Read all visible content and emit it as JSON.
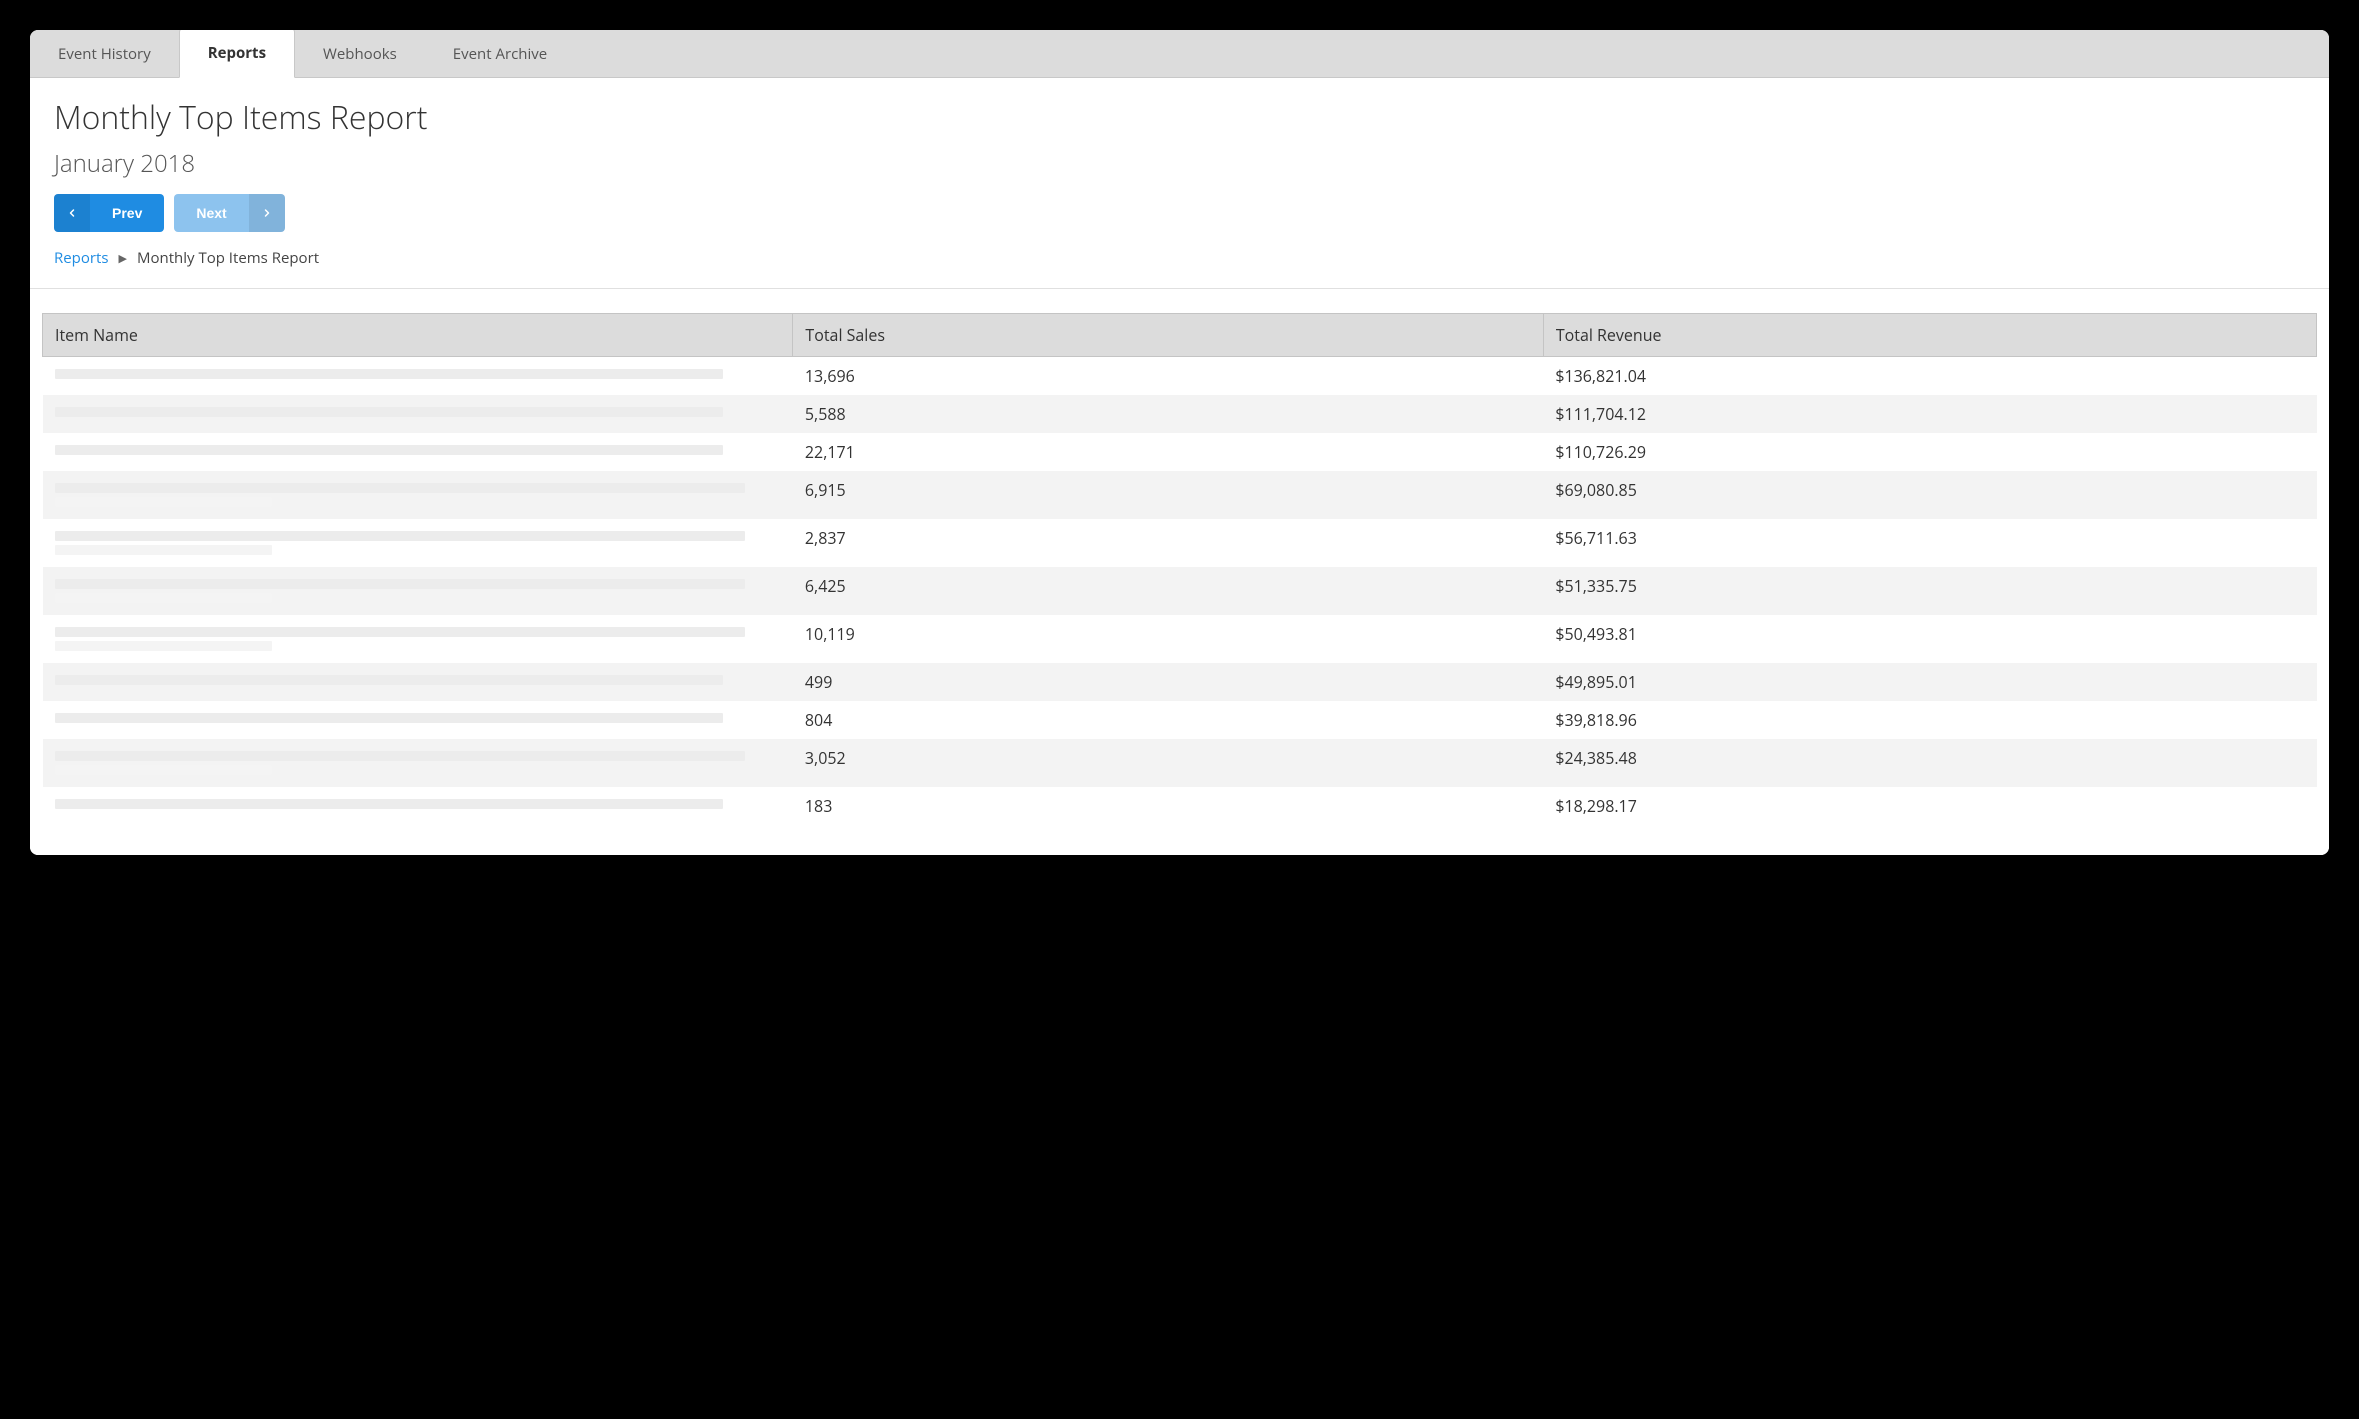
{
  "tabs": [
    {
      "label": "Event History",
      "active": false
    },
    {
      "label": "Reports",
      "active": true
    },
    {
      "label": "Webhooks",
      "active": false
    },
    {
      "label": "Event Archive",
      "active": false
    }
  ],
  "header": {
    "title": "Monthly Top Items Report",
    "subtitle": "January 2018",
    "prev_label": "Prev",
    "next_label": "Next"
  },
  "breadcrumb": {
    "root": "Reports",
    "current": "Monthly Top Items Report"
  },
  "table": {
    "columns": [
      "Item Name",
      "Total Sales",
      "Total Revenue"
    ],
    "rows": [
      {
        "name_hidden": true,
        "lines": 1,
        "sales": "13,696",
        "revenue": "$136,821.04"
      },
      {
        "name_hidden": true,
        "lines": 1,
        "sales": "5,588",
        "revenue": "$111,704.12"
      },
      {
        "name_hidden": true,
        "lines": 1,
        "sales": "22,171",
        "revenue": "$110,726.29"
      },
      {
        "name_hidden": true,
        "lines": 2,
        "sales": "6,915",
        "revenue": "$69,080.85"
      },
      {
        "name_hidden": true,
        "lines": 2,
        "sales": "2,837",
        "revenue": "$56,711.63"
      },
      {
        "name_hidden": true,
        "lines": 2,
        "sales": "6,425",
        "revenue": "$51,335.75"
      },
      {
        "name_hidden": true,
        "lines": 2,
        "sales": "10,119",
        "revenue": "$50,493.81"
      },
      {
        "name_hidden": true,
        "lines": 1,
        "sales": "499",
        "revenue": "$49,895.01"
      },
      {
        "name_hidden": true,
        "lines": 1,
        "sales": "804",
        "revenue": "$39,818.96"
      },
      {
        "name_hidden": true,
        "lines": 2,
        "sales": "3,052",
        "revenue": "$24,385.48"
      },
      {
        "name_hidden": true,
        "lines": 1,
        "sales": "183",
        "revenue": "$18,298.17"
      }
    ]
  }
}
